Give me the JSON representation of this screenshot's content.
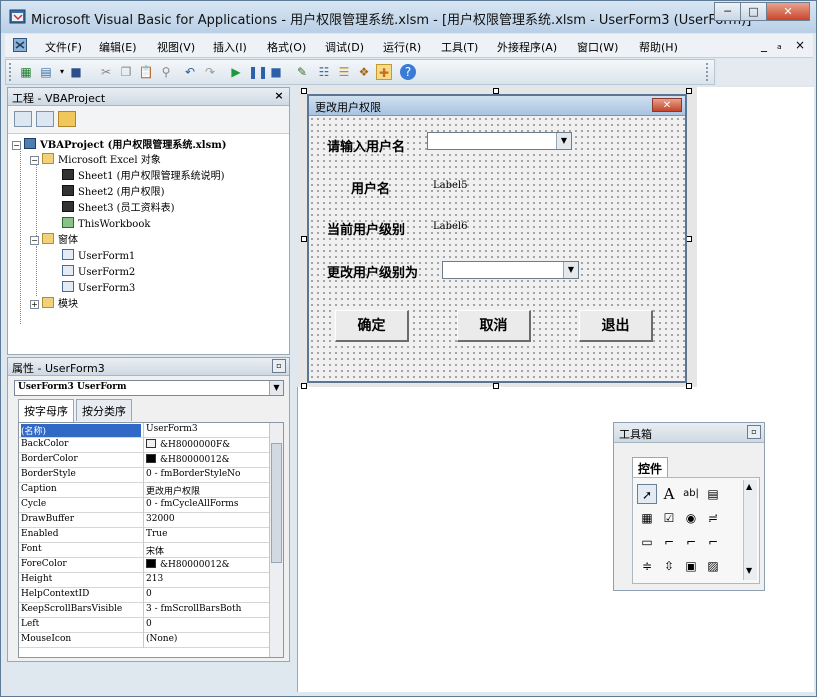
{
  "window": {
    "title": "Microsoft Visual Basic for Applications - 用户权限管理系统.xlsm - [用户权限管理系统.xlsm - UserForm3 (UserForm)]",
    "minimize": "─",
    "maximize": "□",
    "close": "✕"
  },
  "menu": {
    "items": [
      "文件(F)",
      "编辑(E)",
      "视图(V)",
      "插入(I)",
      "格式(O)",
      "调试(D)",
      "运行(R)",
      "工具(T)",
      "外接程序(A)",
      "窗口(W)",
      "帮助(H)"
    ],
    "mdi_min": "_",
    "mdi_restore": "ₐ",
    "mdi_close": "×"
  },
  "project_panel": {
    "title": "工程 - VBAProject",
    "close": "×",
    "tree": {
      "root": "VBAProject (用户权限管理系统.xlsm)",
      "excel_objects": "Microsoft Excel 对象",
      "sheet1": "Sheet1 (用户权限管理系统说明)",
      "sheet2": "Sheet2 (用户权限)",
      "sheet3": "Sheet3 (员工资料表)",
      "thisworkbook": "ThisWorkbook",
      "forms_folder": "窗体",
      "form1": "UserForm1",
      "form2": "UserForm2",
      "form3": "UserForm3",
      "modules_folder": "模块"
    }
  },
  "properties_panel": {
    "title": "属性 - UserForm3",
    "combo": "UserForm3 UserForm",
    "tabs": [
      "按字母序",
      "按分类序"
    ],
    "rows": [
      {
        "name": "(名称)",
        "value": "UserForm3"
      },
      {
        "name": "BackColor",
        "value": "&H8000000F&"
      },
      {
        "name": "BorderColor",
        "value": "&H80000012&"
      },
      {
        "name": "BorderStyle",
        "value": "0 - fmBorderStyleNo"
      },
      {
        "name": "Caption",
        "value": "更改用户权限"
      },
      {
        "name": "Cycle",
        "value": "0 - fmCycleAllForms"
      },
      {
        "name": "DrawBuffer",
        "value": "32000"
      },
      {
        "name": "Enabled",
        "value": "True"
      },
      {
        "name": "Font",
        "value": "宋体"
      },
      {
        "name": "ForeColor",
        "value": "&H80000012&"
      },
      {
        "name": "Height",
        "value": "213"
      },
      {
        "name": "HelpContextID",
        "value": "0"
      },
      {
        "name": "KeepScrollBarsVisible",
        "value": "3 - fmScrollBarsBoth"
      },
      {
        "name": "Left",
        "value": "0"
      },
      {
        "name": "MouseIcon",
        "value": "(None)"
      }
    ],
    "swatches": {
      "backcolor": "#f0f0f0",
      "bordercolor": "#000000",
      "forecolor": "#000000"
    }
  },
  "userform": {
    "caption": "更改用户权限",
    "close": "✕",
    "label_input_user": "请输入用户名",
    "label_user": "用户名",
    "label5": "Label5",
    "label_current_level": "当前用户级别",
    "label6": "Label6",
    "label_change_level": "更改用户级别为",
    "btn_ok": "确定",
    "btn_cancel": "取消",
    "btn_exit": "退出",
    "dropdown_arrow": "▼"
  },
  "toolbox": {
    "title": "工具箱",
    "tab": "控件",
    "close": "×"
  }
}
